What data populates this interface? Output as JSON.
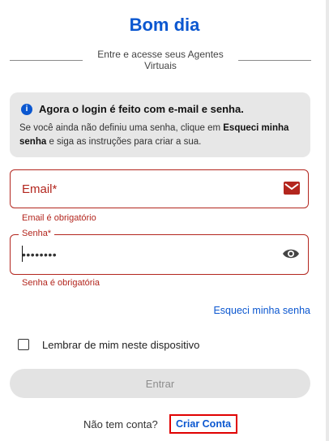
{
  "header": {
    "title": "Bom dia",
    "subtitle": "Entre e acesse seus Agentes Virtuais"
  },
  "info": {
    "icon": "info-icon",
    "title": "Agora o login é feito com e-mail e senha.",
    "text_before": "Se você ainda não definiu uma senha, clique em ",
    "text_bold": "Esqueci minha senha",
    "text_after": " e siga as instruções para criar a sua."
  },
  "form": {
    "email": {
      "label": "Email*",
      "value": "",
      "error": "Email é obrigatório",
      "icon": "mail-icon"
    },
    "password": {
      "label": "Senha*",
      "value": "••••••••",
      "error": "Senha é obrigatória",
      "icon": "eye-icon"
    },
    "forgot_password": "Esqueci minha senha",
    "remember_me": {
      "label": "Lembrar de mim neste dispositivo",
      "checked": false
    },
    "submit_label": "Entrar"
  },
  "footer": {
    "prompt": "Não tem conta?",
    "signup_link": "Criar Conta"
  },
  "colors": {
    "accent": "#0b57d0",
    "error": "#b3261e",
    "highlight_box": "#e00000"
  }
}
